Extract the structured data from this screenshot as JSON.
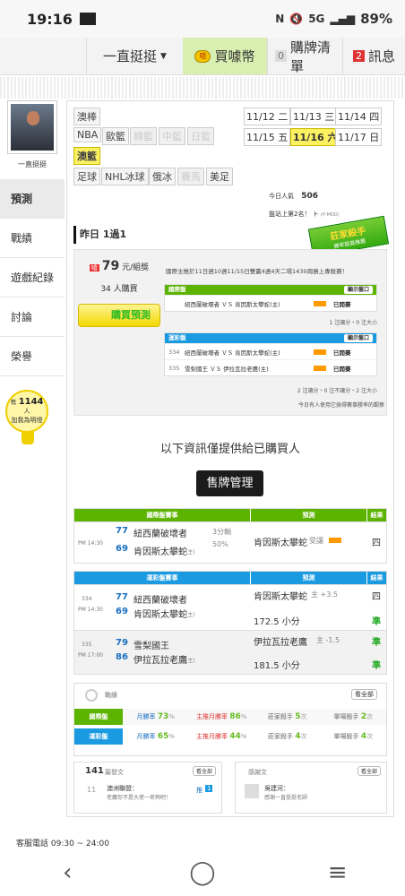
{
  "status": {
    "time": "19:16",
    "net": "5G",
    "battery": "89%"
  },
  "topnav": {
    "user": "一直挺挺",
    "buy": "買噱幣",
    "coin": "嗆",
    "cart_count": "0",
    "cart": "購牌清單",
    "msg_count": "2",
    "msg": "訊息"
  },
  "sidebar": {
    "name": "一直挺挺",
    "items": [
      "預測",
      "戰績",
      "遊戲紀錄",
      "討論",
      "榮譽"
    ],
    "bulb_pre": "有",
    "bulb_count": "1144",
    "bulb_unit": "人",
    "bulb_text": "加我為明燈"
  },
  "leagues": {
    "row1": [
      "澳棒"
    ],
    "row2": [
      "NBA",
      "歐籃",
      "韓籃",
      "中籃",
      "日籃"
    ],
    "row3": [
      "澳籃"
    ],
    "row4": [
      "足球",
      "NHL冰球",
      "俄冰",
      "賽馬",
      "美足"
    ]
  },
  "dates": [
    "11/12 二",
    "11/13 三",
    "11/14 四",
    "11/15 五",
    "11/16 六",
    "11/17 日"
  ],
  "popularity": {
    "label": "今日人氣",
    "value": "506",
    "rank": "盤站上第2名！ ト",
    "small": "(P-MOD)",
    "stamp": "莊家殺手",
    "stamp_sub": "勝率超高推薦"
  },
  "section": {
    "title": "昨日 1過1"
  },
  "pred": {
    "price": "79",
    "price_unit": "元/組獎",
    "buyers": "34",
    "buyers_unit": "人購買",
    "buy_btn": "購買預測",
    "note": "國際主推於11日週10週11/15日雙贏4週4天二場1430周勝上專殺賽！",
    "intl_title": "國際盤",
    "show": "顯示盤口",
    "intl_rows": [
      {
        "n": "",
        "t": "紐西蘭破壞者 ＶＳ 肯因斯太攀蛇(主)",
        "s": "已開賽"
      }
    ],
    "intl_note": "1 注讓分・0 注大小",
    "tw_title": "運彩盤",
    "tw_rows": [
      {
        "n": "334",
        "t": "紐西蘭破壞者 ＶＳ 肯因斯太攀蛇(主)",
        "s": "已開賽"
      },
      {
        "n": "335",
        "t": "雪梨國王 ＶＳ 伊拉瓦拉老鷹(主)",
        "s": "已開賽"
      }
    ],
    "tw_note": "2 注讓分・0 注不讓分・2 注大小",
    "footer": "今日有人使用它換得賽事勝率的觀察"
  },
  "info": {
    "only": "以下資訊僅提供給已購買人",
    "sell": "售牌管理"
  },
  "intl_table": {
    "h1": "國際盤賽事",
    "h2": "預測",
    "h3": "結果",
    "time": "PM 14:30",
    "away_no": "77",
    "away": "紐西蘭破壞者",
    "home_no": "69",
    "home": "肯因斯太攀蛇",
    "home_tag": "(主)",
    "line1": "3分輸",
    "line2": "50%",
    "pick": "肯因斯太攀蛇",
    "pick_extra": "受讓",
    "result": "四"
  },
  "tw_table": {
    "h1": "運彩盤賽事",
    "h2": "預測",
    "h3": "結果",
    "games": [
      {
        "no": "334",
        "time": "PM 14:30",
        "away_no": "77",
        "away": "紐西蘭破壞者",
        "home_no": "69",
        "home": "肯因斯太攀蛇",
        "home_tag": "(主)",
        "pick1": "肯因斯太攀蛇",
        "pick1_extra": "主 +3.5",
        "res1": "四",
        "pick2": "172.5 小分",
        "res2": "準"
      },
      {
        "no": "335",
        "time": "PM 17:00",
        "away_no": "79",
        "away": "雪梨國王",
        "home_no": "86",
        "home": "伊拉瓦拉老鷹",
        "home_tag": "(主)",
        "pick1": "伊拉瓦拉老鷹",
        "pick1_extra": "主 -1.5",
        "res1": "準",
        "pick2": "181.5 小分",
        "res2": "準"
      }
    ]
  },
  "stats": {
    "title": "戰績",
    "all": "看全部",
    "rows": [
      {
        "label": "國際盤",
        "c1": "月勝率",
        "v1": "73",
        "u1": "%",
        "c2": "主推月勝率",
        "v2": "86",
        "u2": "%",
        "c3": "莊家殺手",
        "v3": "5",
        "u3": "次",
        "c4": "單場殺手",
        "v4": "2",
        "u4": "次"
      },
      {
        "label": "運彩盤",
        "c1": "月勝率",
        "v1": "65",
        "u1": "%",
        "c2": "主推月勝率",
        "v2": "44",
        "u2": "%",
        "c3": "莊家殺手",
        "v3": "4",
        "u3": "次",
        "c4": "單場殺手",
        "v4": "4",
        "u4": "次"
      }
    ]
  },
  "boxes": {
    "left_count": "141",
    "left_title": "篇發文",
    "left_more": "看全部",
    "left_date": "11",
    "left_item": "澳洲聯盟：",
    "left_sub": "老鷹你不是大佬一密夠吧！",
    "left_badge_a": "推",
    "left_badge_b": "1",
    "right_title": "感謝文",
    "right_more": "看全部",
    "right_item": "吳建河：",
    "right_sub": "感謝一直挺挺老師"
  },
  "footer": {
    "service": "客服電話 09:30 ~ 24:00"
  },
  "colors": {
    "green": "#5cb300",
    "blue": "#1a9ae0",
    "yellow": "#fcf160"
  }
}
